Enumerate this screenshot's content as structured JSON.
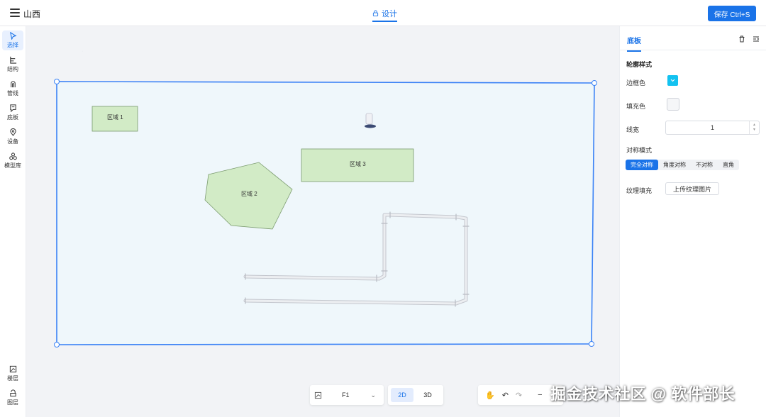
{
  "header": {
    "app_title": "山西",
    "tab_label": "设计",
    "save_label": "保存 Ctrl+S"
  },
  "left_toolbar": [
    {
      "id": "select",
      "label": "选择",
      "icon": "cursor-icon",
      "active": true
    },
    {
      "id": "structure",
      "label": "结构",
      "icon": "structure-icon"
    },
    {
      "id": "pipeline",
      "label": "管线",
      "icon": "pipeline-icon"
    },
    {
      "id": "baseplate",
      "label": "底板",
      "icon": "baseplate-icon"
    },
    {
      "id": "device",
      "label": "设备",
      "icon": "location-pin-icon"
    },
    {
      "id": "model-lib",
      "label": "模型库",
      "icon": "model-library-icon"
    },
    {
      "id": "floor",
      "label": "楼层",
      "icon": "floor-icon"
    },
    {
      "id": "layer",
      "label": "图层",
      "icon": "layer-icon"
    }
  ],
  "canvas": {
    "regions": [
      {
        "label": "区域 1"
      },
      {
        "label": "区域 2"
      },
      {
        "label": "区域 3"
      }
    ],
    "colors": {
      "board_border": "#3b82f6",
      "board_fill": "#eff7fb",
      "region_fill": "#d2ebc6",
      "region_border": "#7a9a6e"
    }
  },
  "bottom": {
    "floor_value": "F1",
    "modes": [
      "2D",
      "3D"
    ],
    "active_mode": "2D"
  },
  "panel": {
    "tab": "底板",
    "section_title": "轮廓样式",
    "border_color_label": "边框色",
    "border_color": "#13c2f0",
    "fill_color_label": "填充色",
    "line_width_label": "线宽",
    "line_width_value": "1",
    "symmetry_label": "对称模式",
    "symmetry_options": [
      "完全对称",
      "角度对称",
      "不对称",
      "直角"
    ],
    "texture_label": "纹理填充",
    "upload_label": "上传纹理图片"
  },
  "overlay_text": "掘金技术社区 @ 软件部长"
}
